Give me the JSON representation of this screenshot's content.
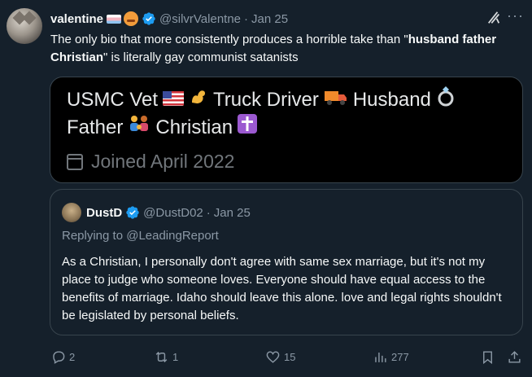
{
  "tweet": {
    "display_name": "valentine",
    "handle": "@silvrValentne",
    "date": "Jan 25",
    "text_part1": "The only bio that more consistently produces a horrible take than \"",
    "text_bold": "husband father Christian",
    "text_part2": "\" is literally gay communist satanists"
  },
  "bio_image": {
    "line1_part1": "USMC Vet",
    "line1_part2": "Truck Driver",
    "line1_part3": "Husband",
    "line2_part1": "Father",
    "line2_part2": "Christian",
    "joined": "Joined April 2022"
  },
  "quote": {
    "display_name": "DustD",
    "handle": "@DustD02",
    "date": "Jan 25",
    "replying": "Replying to @LeadingReport",
    "text": "As a Christian, I personally don't agree with same sex marriage, but it's not my place to judge who someone loves. Everyone should have equal access to the benefits of marriage. Idaho should leave this alone. love and legal rights shouldn't be legislated by personal beliefs."
  },
  "actions": {
    "replies": "2",
    "reposts": "1",
    "likes": "15",
    "views": "277"
  },
  "colors": {
    "background": "#15202b",
    "accent": "#1d9bf0",
    "muted": "#8b98a5"
  }
}
